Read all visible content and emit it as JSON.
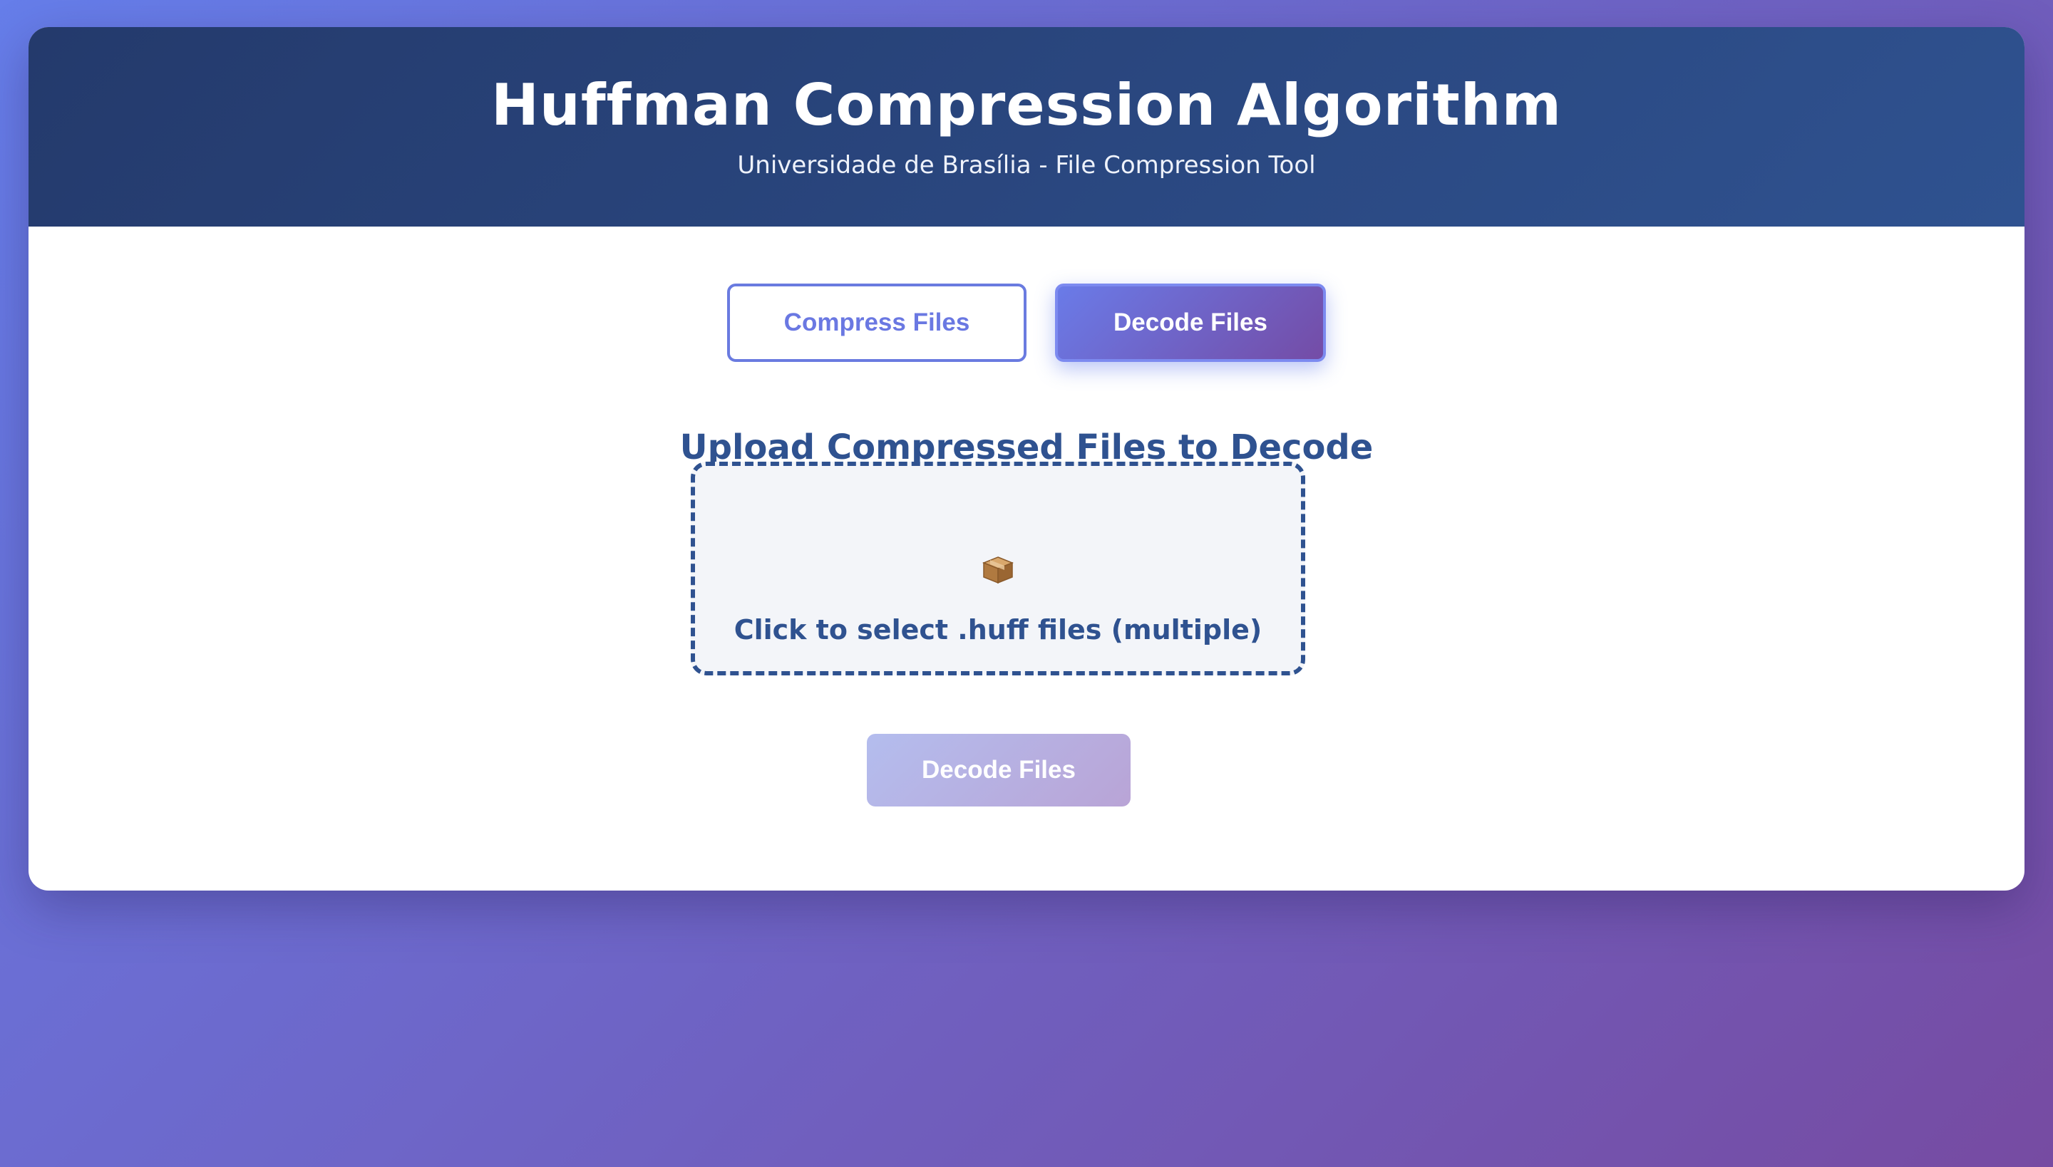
{
  "header": {
    "title": "Huffman Compression Algorithm",
    "subtitle": "Universidade de Brasília - File Compression Tool"
  },
  "tabs": [
    {
      "label": "Compress Files",
      "active": false
    },
    {
      "label": "Decode Files",
      "active": true
    }
  ],
  "section": {
    "title": "Upload Compressed Files to Decode"
  },
  "dropzone": {
    "icon": "package-icon",
    "text": "Click to select .huff files (multiple)"
  },
  "actions": {
    "decode_label": "Decode Files",
    "decode_enabled": false
  },
  "colors": {
    "background_gradient_start": "#667eea",
    "background_gradient_end": "#764ba2",
    "header_dark": "#243a6c",
    "header_light": "#2f5290",
    "accent": "#6a7be0",
    "text_primary": "#2f5290"
  }
}
